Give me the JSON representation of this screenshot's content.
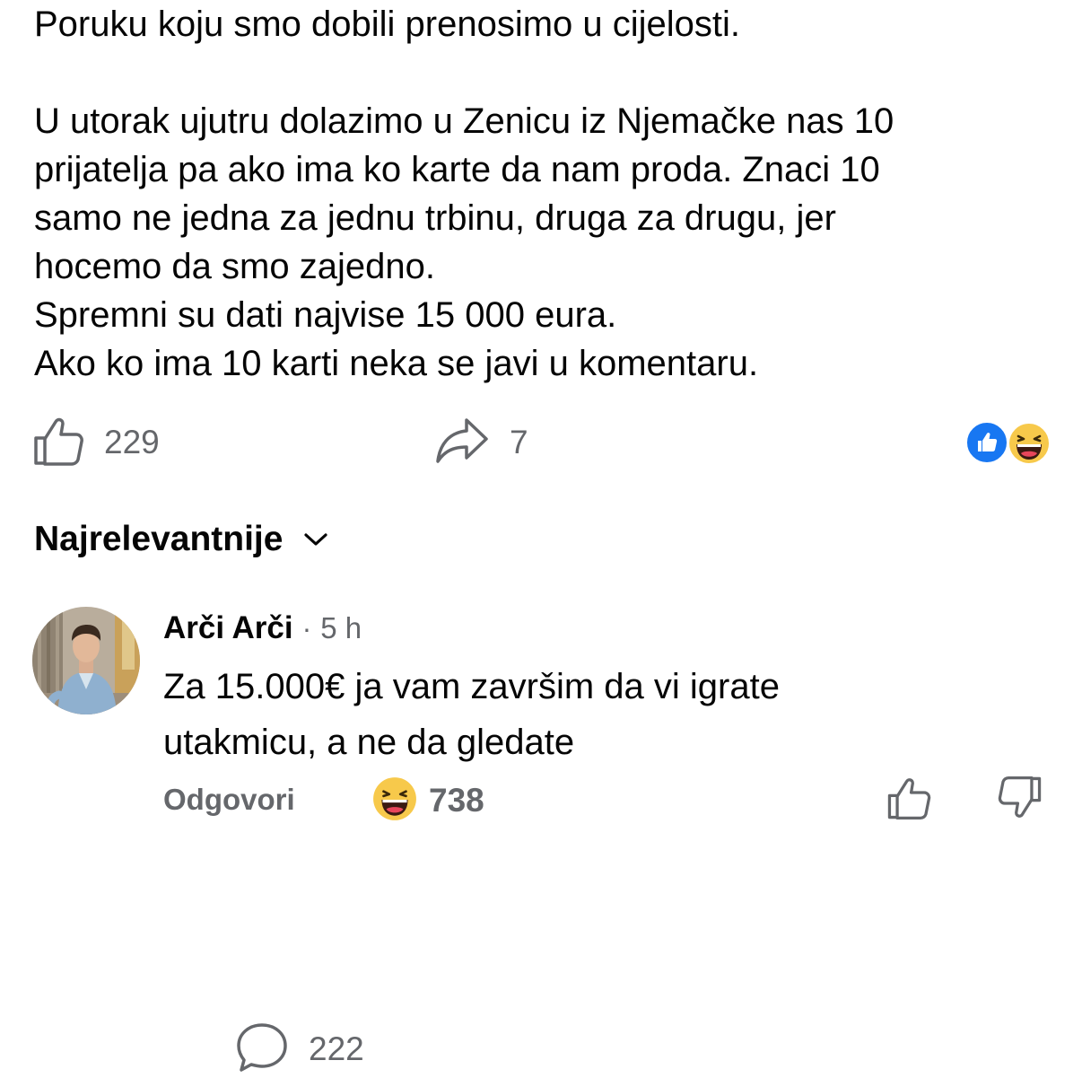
{
  "post": {
    "intro": "Poruku koju smo dobili prenosimo u cijelosti.",
    "lines": [
      "U utorak ujutru dolazimo u Zenicu iz Njemačke nas 10",
      "prijatelja pa ako ima ko karte da nam proda. Znaci 10",
      "samo ne jedna za jednu trbinu, druga za drugu, jer",
      "hocemo da smo zajedno.",
      "Spremni su dati najvise 15 000 eura.",
      "Ako ko ima 10 karti neka se javi u komentaru."
    ]
  },
  "actions": {
    "likes": "229",
    "comments": "222",
    "shares": "7"
  },
  "reaction_icons": [
    "like-reaction",
    "haha-reaction"
  ],
  "sort": {
    "label": "Najrelevantnije"
  },
  "comment": {
    "author": "Arči Arči",
    "separator": "·",
    "time": "5 h",
    "lines": [
      "Za 15.000€ ja vam završim da vi igrate",
      "utakmicu, a ne da gledate"
    ],
    "reply_label": "Odgovori",
    "reaction_count": "738"
  },
  "colors": {
    "text": "#050505",
    "secondary": "#65676b",
    "like_blue": "#1877f2",
    "haha_yellow": "#f7c94b"
  }
}
